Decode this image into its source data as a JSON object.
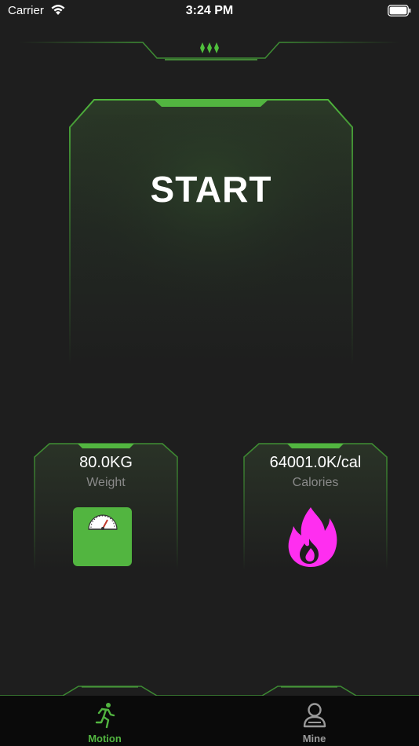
{
  "status_bar": {
    "carrier": "Carrier",
    "time": "3:24 PM"
  },
  "main": {
    "start_label": "START"
  },
  "stats": {
    "weight": {
      "value": "80.0KG",
      "label": "Weight",
      "icon": "scale-icon"
    },
    "calories": {
      "value": "64001.0K/cal",
      "label": "Calories",
      "icon": "flame-icon"
    }
  },
  "tab_bar": {
    "tabs": [
      {
        "label": "Motion",
        "icon": "running-person-icon",
        "active": true
      },
      {
        "label": "Mine",
        "icon": "person-icon",
        "active": false
      }
    ]
  },
  "colors": {
    "accent": "#52b540",
    "background": "#1e1e1e",
    "flame": "#ff2ef0",
    "tab_inactive": "#9a9a9a"
  }
}
